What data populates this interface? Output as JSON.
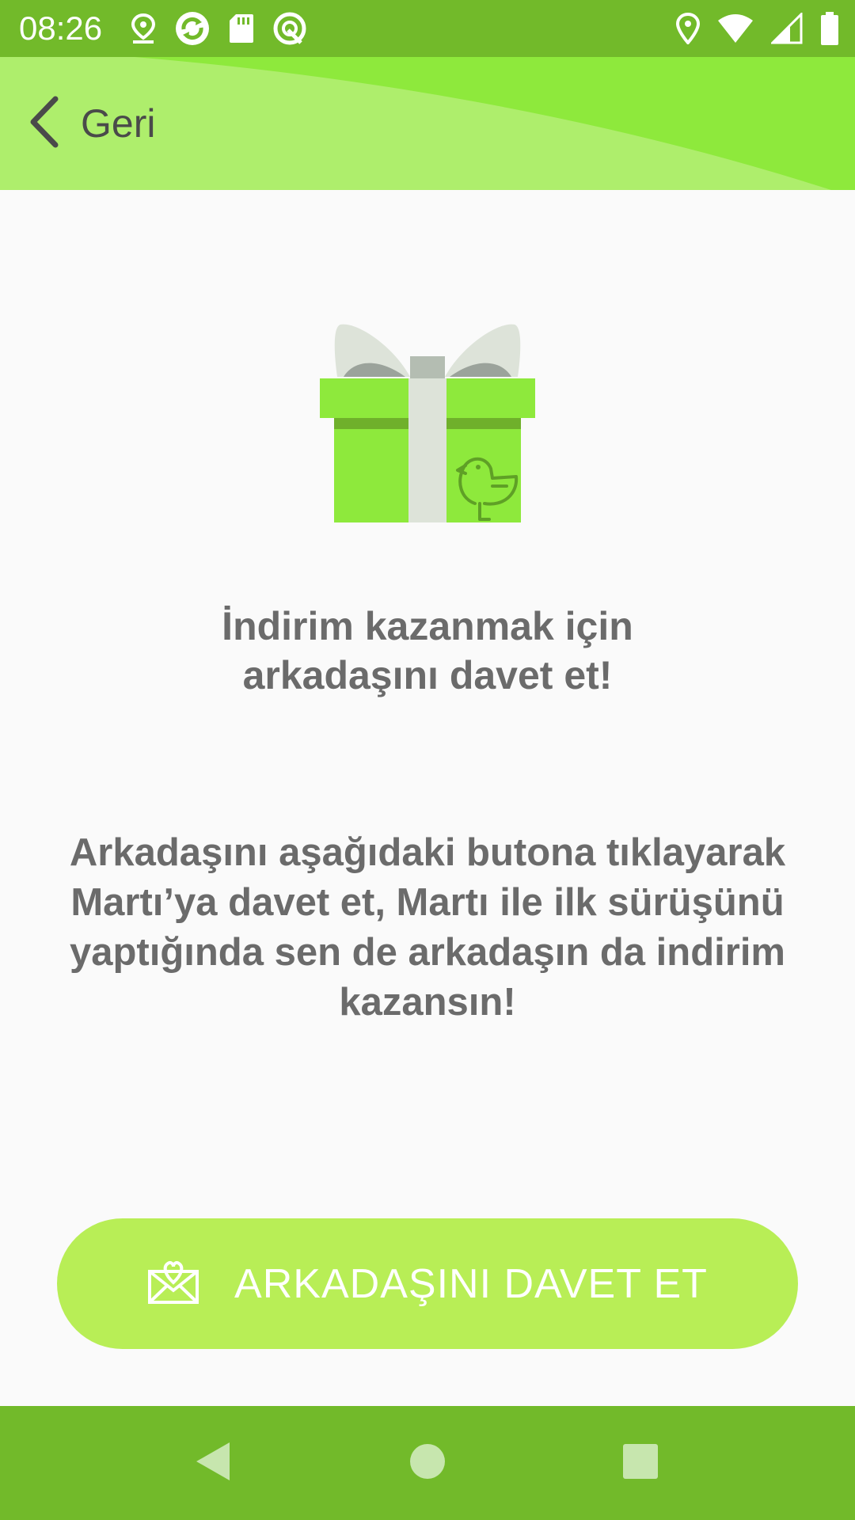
{
  "status_bar": {
    "time": "08:26",
    "left_icons": [
      "location-pin-icon",
      "sync-icon",
      "sd-card-icon",
      "data-saver-icon"
    ],
    "right_icons": [
      "location-icon",
      "wifi-icon",
      "cell-signal-icon",
      "battery-icon"
    ]
  },
  "header": {
    "back_label": "Geri"
  },
  "main": {
    "title": "İndirim kazanmak için\narkadaşını davet et!",
    "description": "Arkadaşını aşağıdaki butona tıklayarak Martı’ya davet et, Martı ile ilk sürüşünü yaptığında sen de arkadaşın da indirim kazansın!"
  },
  "invite_button": {
    "label": "ARKADAŞINI DAVET ET",
    "icon": "envelope-heart-icon"
  },
  "nav_bar": {
    "buttons": [
      "back-triangle-icon",
      "home-circle-icon",
      "recents-square-icon"
    ]
  },
  "colors": {
    "status_bar": "#72ba2a",
    "header": "#8ee93c",
    "button": "#b8ee56",
    "text": "#6b6b6b"
  }
}
